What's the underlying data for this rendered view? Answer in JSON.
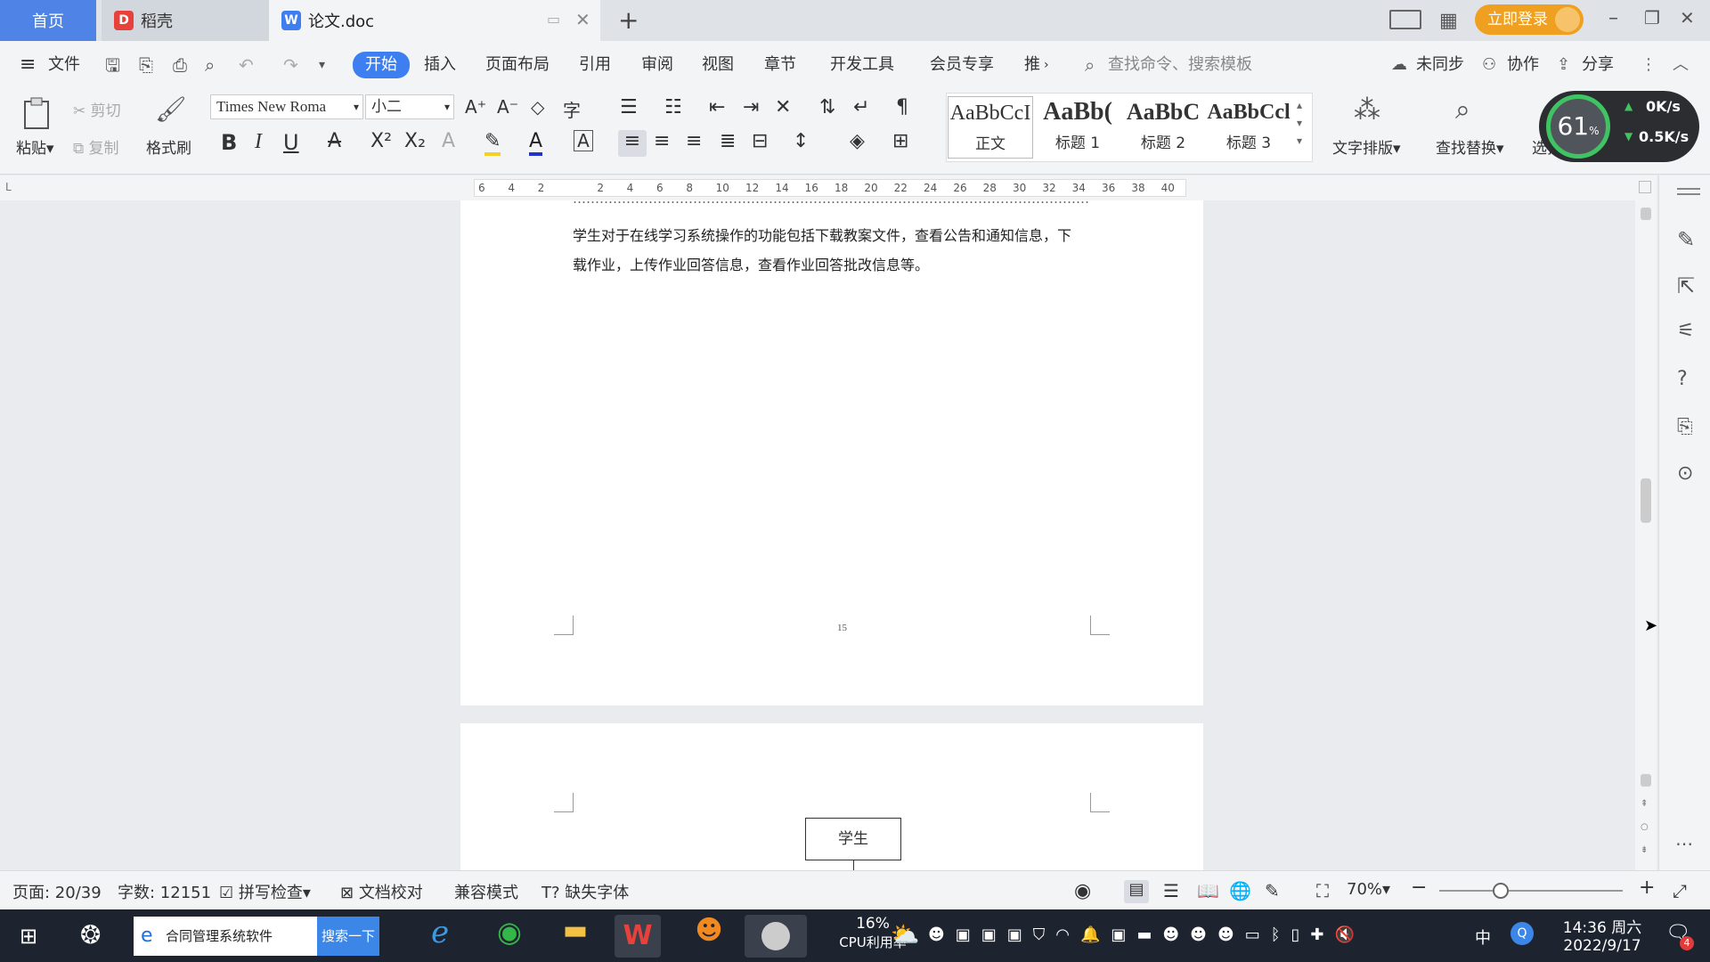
{
  "tabs": {
    "home": "首页",
    "daoke": "稻壳",
    "doc": "论文.doc",
    "add": "+"
  },
  "topright": {
    "login": "立即登录"
  },
  "menu": {
    "file": "文件",
    "items": [
      "开始",
      "插入",
      "页面布局",
      "引用",
      "审阅",
      "视图",
      "章节",
      "开发工具",
      "会员专享",
      "推"
    ],
    "search_placeholder": "查找命令、搜索模板",
    "unsynced": "未同步",
    "collab": "协作",
    "share": "分享"
  },
  "ribbon": {
    "paste": "粘贴",
    "cut": "剪切",
    "copy": "复制",
    "format_painter": "格式刷",
    "font_name": "Times New Roma",
    "font_size": "小二",
    "styles": [
      {
        "preview": "AaBbCcI",
        "name": "正文"
      },
      {
        "preview": "AaBb(",
        "name": "标题 1"
      },
      {
        "preview": "AaBbC",
        "name": "标题 2"
      },
      {
        "preview": "AaBbCcl",
        "name": "标题 3"
      }
    ],
    "text_layout": "文字排版",
    "find_replace": "查找替换",
    "select": "选择",
    "net_percent": "61",
    "net_up": "0K/s",
    "net_down": "0.5K/s"
  },
  "ruler": {
    "ticks": [
      "6",
      "4",
      "2",
      "",
      "2",
      "4",
      "6",
      "8",
      "10",
      "12",
      "14",
      "16",
      "18",
      "20",
      "22",
      "24",
      "26",
      "28",
      "30",
      "32",
      "34",
      "36",
      "38",
      "40"
    ]
  },
  "document": {
    "line_top": "学生对于在线学习系统操作的功能包括下载教案文件，查看公告和通知信息，下",
    "line_bottom": "载作业，上传作业回答信息，查看作业回答批改信息等。",
    "page_number": "15",
    "diagram_box": "学生"
  },
  "status": {
    "page": "页面: 20/39",
    "words": "字数: 12151",
    "spell": "拼写检查",
    "proof": "文档校对",
    "compat": "兼容模式",
    "missing_font": "缺失字体",
    "zoom": "70%"
  },
  "taskbar": {
    "search_text": "合同管理系统软件",
    "search_button": "搜索一下",
    "cpu_percent": "16%",
    "cpu_label": "CPU利用率",
    "ime": "中",
    "time": "14:36 周六",
    "date": "2022/9/17",
    "notif_count": "4"
  }
}
